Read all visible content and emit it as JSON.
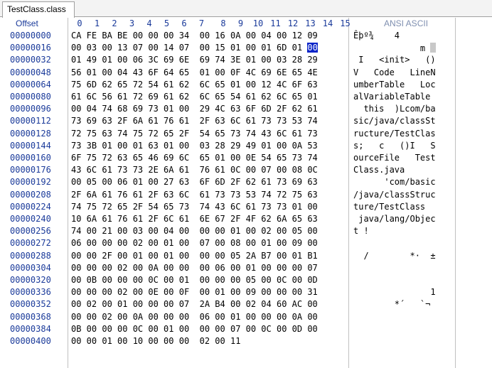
{
  "tab": {
    "title": "TestClass.class"
  },
  "header": {
    "offset_label": "Offset",
    "columns": [
      "0",
      "1",
      "2",
      "3",
      "4",
      "5",
      "6",
      "7",
      "8",
      "9",
      "10",
      "11",
      "12",
      "13",
      "14",
      "15"
    ],
    "ascii_label": "ANSI ASCII"
  },
  "rows": [
    {
      "offset": "00000000",
      "hex": "CA FE BA BE 00 00 00 34  00 16 0A 00 04 00 12 09",
      "ascii": "Êþº¾    4"
    },
    {
      "offset": "00000016",
      "hex": "00 03 00 13 07 00 14 07  00 15 01 00 01 6D 01 00",
      "ascii": "             m "
    },
    {
      "offset": "00000032",
      "hex": "01 49 01 00 06 3C 69 6E  69 74 3E 01 00 03 28 29",
      "ascii": " I   <init>   ()"
    },
    {
      "offset": "00000048",
      "hex": "56 01 00 04 43 6F 64 65  01 00 0F 4C 69 6E 65 4E",
      "ascii": "V   Code   LineN"
    },
    {
      "offset": "00000064",
      "hex": "75 6D 62 65 72 54 61 62  6C 65 01 00 12 4C 6F 63",
      "ascii": "umberTable   Loc"
    },
    {
      "offset": "00000080",
      "hex": "61 6C 56 61 72 69 61 62  6C 65 54 61 62 6C 65 01",
      "ascii": "alVariableTable "
    },
    {
      "offset": "00000096",
      "hex": "00 04 74 68 69 73 01 00  29 4C 63 6F 6D 2F 62 61",
      "ascii": "  this  )Lcom/ba"
    },
    {
      "offset": "00000112",
      "hex": "73 69 63 2F 6A 61 76 61  2F 63 6C 61 73 73 53 74",
      "ascii": "sic/java/classSt"
    },
    {
      "offset": "00000128",
      "hex": "72 75 63 74 75 72 65 2F  54 65 73 74 43 6C 61 73",
      "ascii": "ructure/TestClas"
    },
    {
      "offset": "00000144",
      "hex": "73 3B 01 00 01 63 01 00  03 28 29 49 01 00 0A 53",
      "ascii": "s;   c   ()I   S"
    },
    {
      "offset": "00000160",
      "hex": "6F 75 72 63 65 46 69 6C  65 01 00 0E 54 65 73 74",
      "ascii": "ourceFile   Test"
    },
    {
      "offset": "00000176",
      "hex": "43 6C 61 73 73 2E 6A 61  76 61 0C 00 07 00 08 0C",
      "ascii": "Class.java      "
    },
    {
      "offset": "00000192",
      "hex": "00 05 00 06 01 00 27 63  6F 6D 2F 62 61 73 69 63",
      "ascii": "      'com/basic"
    },
    {
      "offset": "00000208",
      "hex": "2F 6A 61 76 61 2F 63 6C  61 73 73 53 74 72 75 63",
      "ascii": "/java/classStruc"
    },
    {
      "offset": "00000224",
      "hex": "74 75 72 65 2F 54 65 73  74 43 6C 61 73 73 01 00",
      "ascii": "ture/TestClass  "
    },
    {
      "offset": "00000240",
      "hex": "10 6A 61 76 61 2F 6C 61  6E 67 2F 4F 62 6A 65 63",
      "ascii": " java/lang/Objec"
    },
    {
      "offset": "00000256",
      "hex": "74 00 21 00 03 00 04 00  00 00 01 00 02 00 05 00",
      "ascii": "t !             "
    },
    {
      "offset": "00000272",
      "hex": "06 00 00 00 02 00 01 00  07 00 08 00 01 00 09 00",
      "ascii": "                "
    },
    {
      "offset": "00000288",
      "hex": "00 00 2F 00 01 00 01 00  00 00 05 2A B7 00 01 B1",
      "ascii": "  /        *·  ±"
    },
    {
      "offset": "00000304",
      "hex": "00 00 00 02 00 0A 00 00  00 06 00 01 00 00 00 07",
      "ascii": "                "
    },
    {
      "offset": "00000320",
      "hex": "00 0B 00 00 00 0C 00 01  00 00 00 05 00 0C 00 0D",
      "ascii": "                "
    },
    {
      "offset": "00000336",
      "hex": "00 00 00 02 00 0E 00 0F  00 01 00 09 00 00 00 31",
      "ascii": "               1"
    },
    {
      "offset": "00000352",
      "hex": "00 02 00 01 00 00 00 07  2A B4 00 02 04 60 AC 00",
      "ascii": "        *´   `¬ "
    },
    {
      "offset": "00000368",
      "hex": "00 00 02 00 0A 00 00 00  06 00 01 00 00 00 0A 00",
      "ascii": "                "
    },
    {
      "offset": "00000384",
      "hex": "0B 00 00 00 0C 00 01 00  00 00 07 00 0C 00 0D 00",
      "ascii": "                "
    },
    {
      "offset": "00000400",
      "hex": "00 00 01 00 10 00 00 00  02 00 11",
      "ascii": ""
    }
  ],
  "selection": {
    "row": 1,
    "byte": 15,
    "value": "00"
  }
}
